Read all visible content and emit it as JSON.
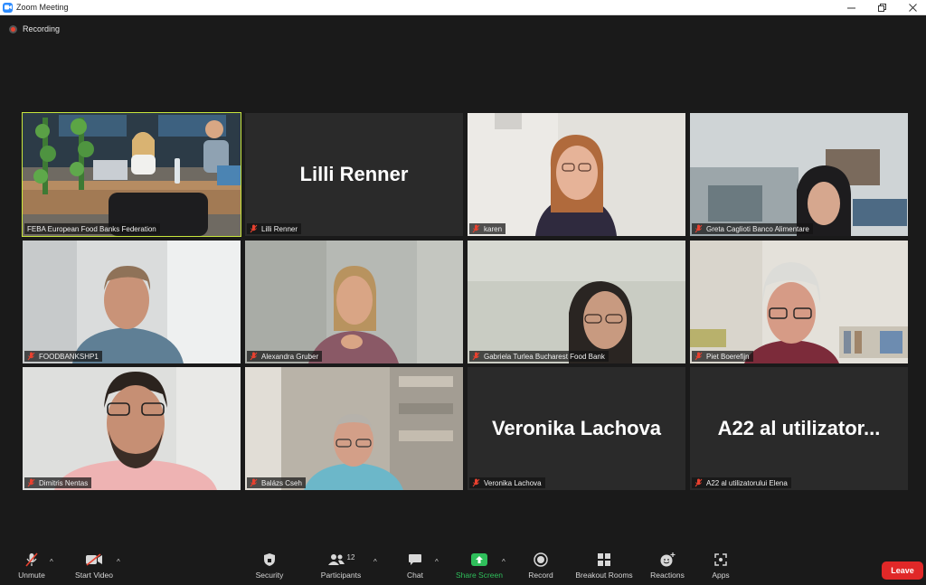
{
  "window": {
    "title": "Zoom Meeting",
    "minimize_icon": "minimize-icon",
    "maximize_icon": "restore-icon",
    "close_icon": "close-icon"
  },
  "recording": {
    "label": "Recording",
    "color": "#e8412f"
  },
  "tiles": [
    {
      "name": "FEBA European Food Banks Federation",
      "big_name": "",
      "video": true,
      "active": true
    },
    {
      "name": "Lilli Renner",
      "big_name": "Lilli Renner",
      "video": false,
      "active": false
    },
    {
      "name": "karen",
      "big_name": "",
      "video": true,
      "active": false
    },
    {
      "name": "Greta Caglioti Banco Alimentare",
      "big_name": "",
      "video": true,
      "active": false
    },
    {
      "name": "FOODBANKSHP1",
      "big_name": "",
      "video": true,
      "active": false
    },
    {
      "name": "Alexandra Gruber",
      "big_name": "",
      "video": true,
      "active": false
    },
    {
      "name": "Gabriela Turlea Bucharest Food Bank",
      "big_name": "",
      "video": true,
      "active": false
    },
    {
      "name": "Piet Boerefijn",
      "big_name": "",
      "video": true,
      "active": false
    },
    {
      "name": "Dimitris Nentas",
      "big_name": "",
      "video": true,
      "active": false
    },
    {
      "name": "Balázs Cseh",
      "big_name": "",
      "video": true,
      "active": false
    },
    {
      "name": "Veronika Lachova",
      "big_name": "Veronika Lachova",
      "video": false,
      "active": false
    },
    {
      "name": "A22 al utilizatorului Elena",
      "big_name": "A22 al utilizator...",
      "video": false,
      "active": false
    }
  ],
  "toolbar": {
    "unmute": "Unmute",
    "start_video": "Start Video",
    "security": "Security",
    "participants": "Participants",
    "participants_count": "12",
    "chat": "Chat",
    "share_screen": "Share Screen",
    "record": "Record",
    "breakout_rooms": "Breakout Rooms",
    "reactions": "Reactions",
    "apps": "Apps",
    "leave": "Leave"
  },
  "colors": {
    "active_speaker": "#c8e63c",
    "share_green": "#2fbf5b",
    "leave_red": "#e02828",
    "muted_red": "#e8412f"
  }
}
